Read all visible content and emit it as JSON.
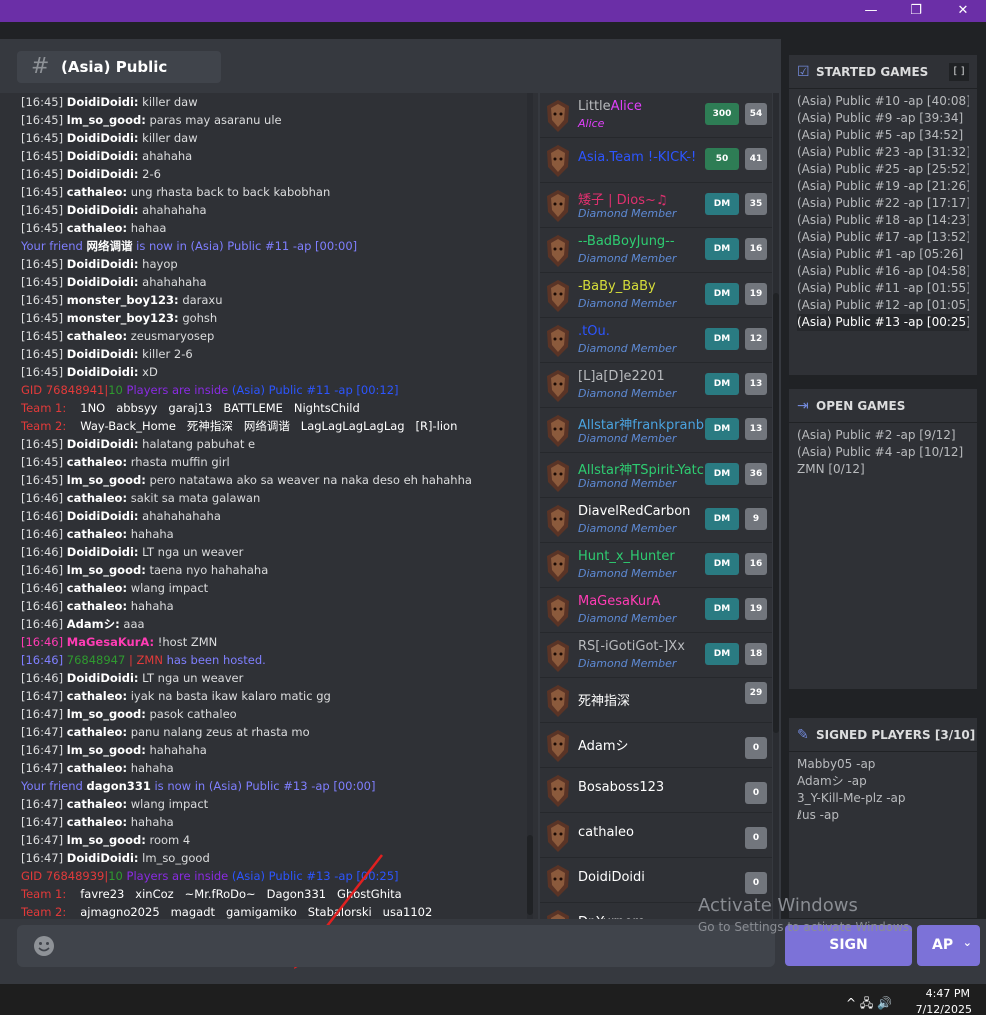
{
  "window": {
    "minimize": "—",
    "restore": "❐",
    "close": "✕"
  },
  "channel": {
    "hash": "#",
    "name": "(Asia) Public"
  },
  "chat": {
    "lines": [
      {
        "kind": "msg",
        "time": "[16:45]",
        "user": "DoidiDoidi:",
        "text": "killer daw"
      },
      {
        "kind": "msg",
        "time": "[16:45]",
        "user": "lm_so_good:",
        "text": "paras may asaranu ule"
      },
      {
        "kind": "msg",
        "time": "[16:45]",
        "user": "DoidiDoidi:",
        "text": "killer daw"
      },
      {
        "kind": "msg",
        "time": "[16:45]",
        "user": "DoidiDoidi:",
        "text": "ahahaha"
      },
      {
        "kind": "msg",
        "time": "[16:45]",
        "user": "DoidiDoidi:",
        "text": "2-6"
      },
      {
        "kind": "msg",
        "time": "[16:45]",
        "user": "cathaleo:",
        "text": "ung rhasta back to back kabobhan"
      },
      {
        "kind": "msg",
        "time": "[16:45]",
        "user": "DoidiDoidi:",
        "text": "ahahahaha"
      },
      {
        "kind": "msg",
        "time": "[16:45]",
        "user": "cathaleo:",
        "text": "hahaa"
      },
      {
        "kind": "friend",
        "pre": "Your friend",
        "name": "网络调谐",
        "post": "is now in (Asia) Public #11 -ap [00:00]"
      },
      {
        "kind": "msg",
        "time": "[16:45]",
        "user": "DoidiDoidi:",
        "text": "hayop"
      },
      {
        "kind": "msg",
        "time": "[16:45]",
        "user": "DoidiDoidi:",
        "text": "ahahahaha"
      },
      {
        "kind": "msg",
        "time": "[16:45]",
        "user": "monster_boy123:",
        "text": "daraxu"
      },
      {
        "kind": "msg",
        "time": "[16:45]",
        "user": "monster_boy123:",
        "text": "gohsh"
      },
      {
        "kind": "msg",
        "time": "[16:45]",
        "user": "cathaleo:",
        "text": "zeusmaryosep"
      },
      {
        "kind": "msg",
        "time": "[16:45]",
        "user": "DoidiDoidi:",
        "text": "killer 2-6"
      },
      {
        "kind": "msg",
        "time": "[16:45]",
        "user": "DoidiDoidi:",
        "text": "xD"
      },
      {
        "kind": "gid",
        "gid": "GID 76848941",
        "num": "10",
        "mid": "Players are inside",
        "game": "(Asia) Public #11 -ap [00:12]"
      },
      {
        "kind": "team",
        "label": "Team 1:",
        "names": "1NO   abbsyy   garaj13   BATTLEME   NightsChild"
      },
      {
        "kind": "team",
        "label": "Team 2:",
        "names": "Way-Back_Home   死神指深   网络调谐   LagLagLagLagLag   [R]-lion"
      },
      {
        "kind": "msg",
        "time": "[16:45]",
        "user": "DoidiDoidi:",
        "text": "halatang pabuhat e"
      },
      {
        "kind": "msg",
        "time": "[16:45]",
        "user": "cathaleo:",
        "text": "rhasta muffin girl"
      },
      {
        "kind": "msg",
        "time": "[16:45]",
        "user": "lm_so_good:",
        "text": "pero natatawa ako sa weaver na naka deso eh hahahha"
      },
      {
        "kind": "msg",
        "time": "[16:46]",
        "user": "cathaleo:",
        "text": "sakit sa mata galawan"
      },
      {
        "kind": "msg",
        "time": "[16:46]",
        "user": "DoidiDoidi:",
        "text": "ahahahahaha"
      },
      {
        "kind": "msg",
        "time": "[16:46]",
        "user": "cathaleo:",
        "text": "hahaha"
      },
      {
        "kind": "msg",
        "time": "[16:46]",
        "user": "DoidiDoidi:",
        "text": "LT nga un weaver"
      },
      {
        "kind": "msg",
        "time": "[16:46]",
        "user": "lm_so_good:",
        "text": "taena nyo hahahaha"
      },
      {
        "kind": "msg",
        "time": "[16:46]",
        "user": "cathaleo:",
        "text": "wlang impact"
      },
      {
        "kind": "msg",
        "time": "[16:46]",
        "user": "cathaleo:",
        "text": "hahaha"
      },
      {
        "kind": "msg",
        "time": "[16:46]",
        "user": "Adamシ:",
        "text": "aaa"
      },
      {
        "kind": "pinkmsg",
        "time": "[16:46]",
        "user": "MaGesaKurA:",
        "text": "!host ZMN"
      },
      {
        "kind": "hosted",
        "time": "[16:46]",
        "gid": "76848947",
        "game": "ZMN",
        "text": "has been hosted."
      },
      {
        "kind": "msg",
        "time": "[16:46]",
        "user": "DoidiDoidi:",
        "text": "LT nga un weaver"
      },
      {
        "kind": "msg",
        "time": "[16:47]",
        "user": "cathaleo:",
        "text": "iyak na basta ikaw kalaro matic gg"
      },
      {
        "kind": "msg",
        "time": "[16:47]",
        "user": "lm_so_good:",
        "text": "pasok cathaleo"
      },
      {
        "kind": "msg",
        "time": "[16:47]",
        "user": "cathaleo:",
        "text": "panu nalang zeus at rhasta mo"
      },
      {
        "kind": "msg",
        "time": "[16:47]",
        "user": "lm_so_good:",
        "text": "hahahaha"
      },
      {
        "kind": "msg",
        "time": "[16:47]",
        "user": "cathaleo:",
        "text": "hahaha"
      },
      {
        "kind": "friend",
        "pre": "Your friend",
        "name": "dagon331",
        "post": "is now in (Asia) Public #13 -ap [00:00]"
      },
      {
        "kind": "msg",
        "time": "[16:47]",
        "user": "cathaleo:",
        "text": "wlang impact"
      },
      {
        "kind": "msg",
        "time": "[16:47]",
        "user": "cathaleo:",
        "text": "hahaha"
      },
      {
        "kind": "msg",
        "time": "[16:47]",
        "user": "lm_so_good:",
        "text": "room 4"
      },
      {
        "kind": "msg",
        "time": "[16:47]",
        "user": "DoidiDoidi:",
        "text": "lm_so_good"
      },
      {
        "kind": "gid",
        "gid": "GID 76848939",
        "num": "10",
        "mid": "Players are inside",
        "game": "(Asia) Public #13 -ap [00:25]"
      },
      {
        "kind": "team",
        "label": "Team 1:",
        "names": "favre23   xinCoz   ~Mr.fRoDo~   Dagon331   GhostGhita"
      },
      {
        "kind": "team",
        "label": "Team 2:",
        "names": "ajmagno2025   magadt   gamigamiko   Stabalorski   usa1102"
      }
    ]
  },
  "players": [
    {
      "name": "LittleAlice",
      "name_a": "Little",
      "name_b": "Alice",
      "color_a": "#b9bbbe",
      "color_b": "#e040fb",
      "sub": "Alice",
      "sub_color": "#e040fb",
      "badge": "300",
      "badge_style": "green",
      "count": "54"
    },
    {
      "name": "Asia.Team  !-KICK-!",
      "color_a": "#2c55ff",
      "sub": "",
      "badge": "50",
      "badge_style": "green",
      "count": "41"
    },
    {
      "name": "矮子 | Dios~♫",
      "color_a": "#e0306f",
      "sub": "Diamond Member",
      "badge": "DM",
      "count": "35"
    },
    {
      "name": "--BadBoyJung--",
      "color_a": "#2ecc71",
      "sub": "Diamond Member",
      "badge": "DM",
      "count": "16"
    },
    {
      "name": "-BaBy_BaBy",
      "color_a": "#d7df3a",
      "sub": "Diamond Member",
      "badge": "DM",
      "count": "19"
    },
    {
      "name": ".tOu.",
      "color_a": "#2c55ff",
      "sub": "Diamond Member",
      "badge": "DM",
      "count": "12"
    },
    {
      "name": "[L]a[D]e2201",
      "color_a": "#b9bbbe",
      "sub": "Diamond Member",
      "badge": "DM",
      "count": "13"
    },
    {
      "name": "Allstar神frankpranb",
      "color_a": "#4aa3df",
      "sub": "Diamond Member",
      "badge": "DM",
      "count": "13"
    },
    {
      "name": "Allstar神TSpirit-Yatc",
      "color_a": "#2ecc71",
      "sub": "Diamond Member",
      "badge": "DM",
      "count": "36"
    },
    {
      "name": "DiavelRedCarbon",
      "color_a": "#ffffff",
      "sub": "Diamond Member",
      "badge": "DM",
      "count": "9"
    },
    {
      "name": "Hunt_x_Hunter",
      "color_a": "#2ecc71",
      "sub": "Diamond Member",
      "badge": "DM",
      "count": "16"
    },
    {
      "name": "MaGesaKurA",
      "color_a": "#ff3cb4",
      "sub": "Diamond Member",
      "badge": "DM",
      "count": "19"
    },
    {
      "name": "RS[-iGotiGot-]Xx",
      "color_a": "#b9bbbe",
      "sub": "Diamond Member",
      "badge": "DM",
      "count": "18"
    },
    {
      "name": "死神指深",
      "color_a": "#ffffff",
      "sub": "",
      "badge": "",
      "count": "29"
    },
    {
      "name": "Adamシ",
      "color_a": "#ffffff",
      "sub": "",
      "badge": "",
      "count": "0"
    },
    {
      "name": "Bosaboss123",
      "color_a": "#ffffff",
      "sub": "",
      "badge": "",
      "count": "0"
    },
    {
      "name": "cathaleo",
      "color_a": "#ffffff",
      "sub": "",
      "badge": "",
      "count": "0"
    },
    {
      "name": "DoidiDoidi",
      "color_a": "#ffffff",
      "sub": "",
      "badge": "",
      "count": "0"
    },
    {
      "name": "Dr.Yurnero",
      "color_a": "#ffffff",
      "sub": "",
      "badge": "",
      "count": ""
    }
  ],
  "started_games": {
    "title": "STARTED GAMES",
    "button": "[ ]",
    "items": [
      "(Asia) Public #10 -ap [40:08]",
      "(Asia) Public #9 -ap [39:34]",
      "(Asia) Public #5 -ap [34:52]",
      "(Asia) Public #23 -ap [31:32]",
      "(Asia) Public #25 -ap [25:52]",
      "(Asia) Public #19 -ap [21:26]",
      "(Asia) Public #22 -ap [17:17]",
      "(Asia) Public #18 -ap [14:23]",
      "(Asia) Public #17 -ap [13:52]",
      "(Asia) Public #1 -ap [05:26]",
      "(Asia) Public #16 -ap [04:58]",
      "(Asia) Public #11 -ap [01:55]",
      "(Asia) Public #12 -ap [01:05]",
      "(Asia) Public #13 -ap [00:25]"
    ]
  },
  "open_games": {
    "title": "OPEN GAMES",
    "items": [
      "(Asia) Public #2 -ap [9/12]",
      "(Asia) Public #4 -ap [10/12]",
      "ZMN [0/12]"
    ]
  },
  "signed_players": {
    "title": "SIGNED PLAYERS [3/10]",
    "items": [
      "Mabby05 -ap",
      "Adamシ -ap",
      "3_Y-Kill-Me-plz -ap",
      "ℓus -ap"
    ]
  },
  "bottom": {
    "sign": "SIGN",
    "mode": "AP",
    "mode_chevron": "⌄"
  },
  "watermark": {
    "line1": "Activate Windows",
    "line2": "Go to Settings to activate Windows."
  },
  "taskbar": {
    "time": "4:47 PM",
    "date": "7/12/2025",
    "tray": "^  🖧  🔊"
  },
  "colors": {
    "titlebar": "#6b2fa7",
    "accent": "#7c72d8",
    "badge_dm": "#2a7b82"
  }
}
